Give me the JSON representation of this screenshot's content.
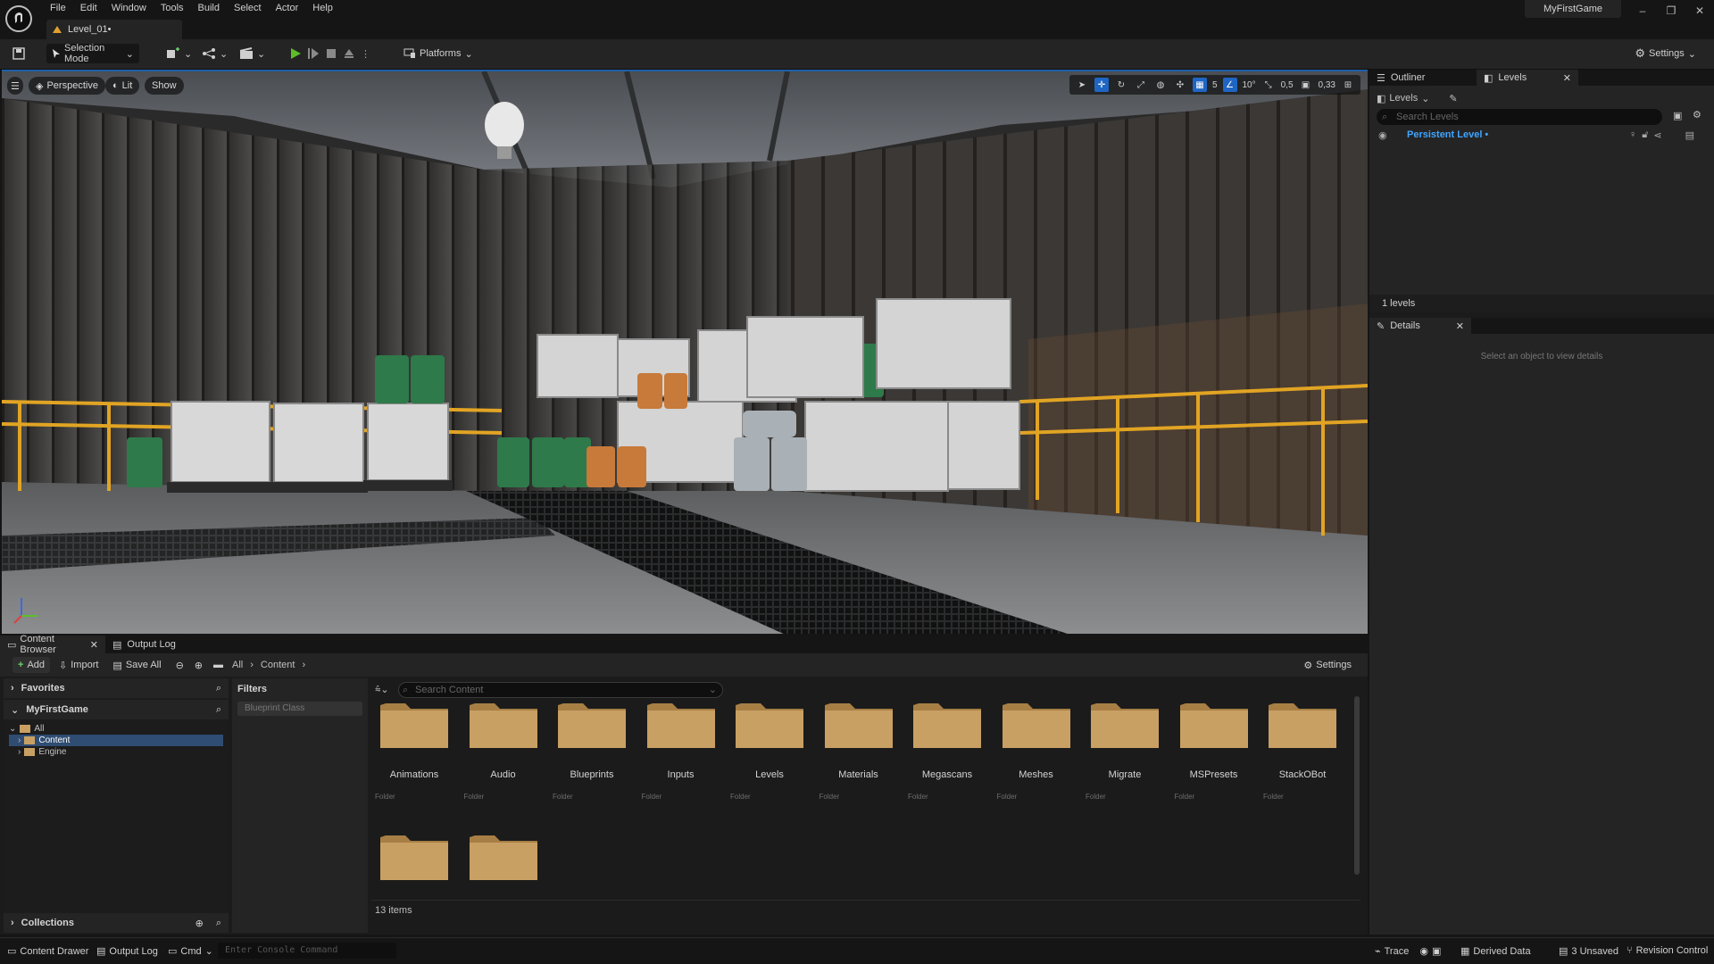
{
  "app": {
    "project_name": "MyFirstGame",
    "level_tab": "Level_01•"
  },
  "menu": [
    "File",
    "Edit",
    "Window",
    "Tools",
    "Build",
    "Select",
    "Actor",
    "Help"
  ],
  "window_controls": [
    "–",
    "❐",
    "✕"
  ],
  "toolbar": {
    "selection_mode": "Selection Mode",
    "platforms": "Platforms",
    "settings": "Settings"
  },
  "viewport": {
    "perspective": "Perspective",
    "lit": "Lit",
    "show": "Show",
    "grid_snap": "5",
    "rotation_snap": "10°",
    "scale_snap": "0,5",
    "camera_speed": "0,33"
  },
  "outliner": {
    "tabs": [
      "Outliner",
      "Levels"
    ],
    "levels_dropdown": "Levels",
    "search_placeholder": "Search Levels",
    "persistent_level": "Persistent Level •",
    "count": "1 levels"
  },
  "details": {
    "tab": "Details",
    "hint": "Select an object to view details"
  },
  "content_browser": {
    "tabs": [
      "Content Browser",
      "Output Log"
    ],
    "add": "Add",
    "import": "Import",
    "save_all": "Save All",
    "breadcrumb": [
      "All",
      "Content"
    ],
    "settings": "Settings",
    "favorites": "Favorites",
    "project": "MyFirstGame",
    "tree": [
      "All",
      "Content",
      "Engine"
    ],
    "collections": "Collections",
    "filters_label": "Filters",
    "filter_chip": "Blueprint Class",
    "search_placeholder": "Search Content",
    "folders": [
      "Animations",
      "Audio",
      "Blueprints",
      "Inputs",
      "Levels",
      "Materials",
      "Megascans",
      "Meshes",
      "Migrate",
      "MSPresets",
      "StackOBot"
    ],
    "folder_type": "Folder",
    "item_count": "13 items"
  },
  "status_bar": {
    "content_drawer": "Content Drawer",
    "output_log": "Output Log",
    "cmd": "Cmd",
    "console_placeholder": "Enter Console Command",
    "trace": "Trace",
    "derived_data": "Derived Data",
    "unsaved": "3 Unsaved",
    "revision_control": "Revision Control"
  },
  "colors": {
    "accent": "#1f66c4",
    "play": "#5cbf2a",
    "level_link": "#3fa6ff",
    "folder": "#c9a063",
    "rail": "#e1a423"
  }
}
